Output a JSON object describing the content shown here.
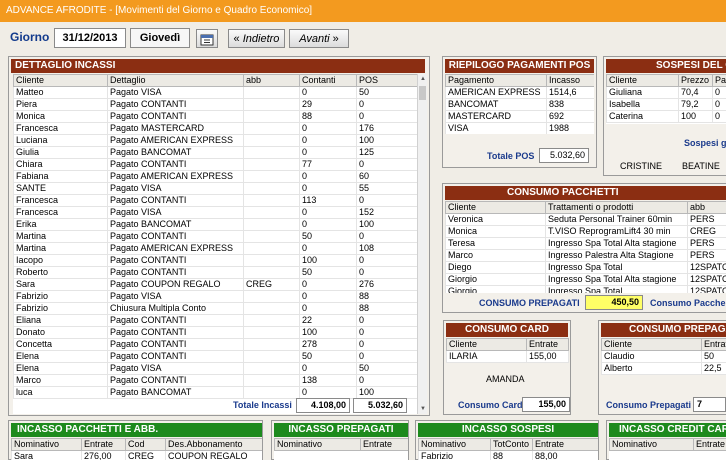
{
  "window": {
    "title": "ADVANCE AFRODITE - [Movimenti del Giorno e Quadro Economico]"
  },
  "nav": {
    "giorno_label": "Giorno",
    "date": "31/12/2013",
    "weekday": "Giovedì",
    "prev_label": "Indietro",
    "next_label": "Avanti"
  },
  "incassi": {
    "title": "DETTAGLIO INCASSI",
    "columns": [
      "Cliente",
      "Dettaglio",
      "abb",
      "Contanti",
      "POS"
    ],
    "rows": [
      [
        "Matteo",
        "Pagato VISA",
        "",
        "0",
        "50"
      ],
      [
        "Piera",
        "Pagato CONTANTI",
        "",
        "29",
        "0"
      ],
      [
        "Monica",
        "Pagato CONTANTI",
        "",
        "88",
        "0"
      ],
      [
        "Francesca",
        "Pagato MASTERCARD",
        "",
        "0",
        "176"
      ],
      [
        "Luciana",
        "Pagato AMERICAN EXPRESS",
        "",
        "0",
        "100"
      ],
      [
        "Giulia",
        "Pagato BANCOMAT",
        "",
        "0",
        "125"
      ],
      [
        "Chiara",
        "Pagato CONTANTI",
        "",
        "77",
        "0"
      ],
      [
        "Fabiana",
        "Pagato AMERICAN EXPRESS",
        "",
        "0",
        "60"
      ],
      [
        "SANTE",
        "Pagato VISA",
        "",
        "0",
        "55"
      ],
      [
        "Francesca",
        "Pagato CONTANTI",
        "",
        "113",
        "0"
      ],
      [
        "Francesca",
        "Pagato VISA",
        "",
        "0",
        "152"
      ],
      [
        "Erika",
        "Pagato BANCOMAT",
        "",
        "0",
        "100"
      ],
      [
        "Martina",
        "Pagato CONTANTI",
        "",
        "50",
        "0"
      ],
      [
        "Martina",
        "Pagato AMERICAN EXPRESS",
        "",
        "0",
        "108"
      ],
      [
        "Iacopo",
        "Pagato CONTANTI",
        "",
        "100",
        "0"
      ],
      [
        "Roberto",
        "Pagato CONTANTI",
        "",
        "50",
        "0"
      ],
      [
        "Sara",
        "Pagato COUPON REGALO",
        "CREG",
        "0",
        "276"
      ],
      [
        "Fabrizio",
        "Pagato VISA",
        "",
        "0",
        "88"
      ],
      [
        "Fabrizio",
        "Chiusura Multipla Conto",
        "",
        "0",
        "88"
      ],
      [
        "Eliana",
        "Pagato CONTANTI",
        "",
        "22",
        "0"
      ],
      [
        "Donato",
        "Pagato CONTANTI",
        "",
        "100",
        "0"
      ],
      [
        "Concetta",
        "Pagato CONTANTI",
        "",
        "278",
        "0"
      ],
      [
        "Elena",
        "Pagato CONTANTI",
        "",
        "50",
        "0"
      ],
      [
        "Elena",
        "Pagato VISA",
        "",
        "0",
        "50"
      ],
      [
        "Marco",
        "Pagato CONTANTI",
        "",
        "138",
        "0"
      ],
      [
        "luca",
        "Pagato BANCOMAT",
        "",
        "0",
        "100"
      ]
    ],
    "total_label": "Totale Incassi",
    "total_contanti": "4.108,00",
    "total_pos": "5.032,60"
  },
  "pos": {
    "title": "RIEPILOGO PAGAMENTI POS",
    "columns": [
      "Pagamento",
      "Incasso"
    ],
    "rows": [
      [
        "AMERICAN EXPRESS",
        "1514,6"
      ],
      [
        "BANCOMAT",
        "838"
      ],
      [
        "MASTERCARD",
        "692"
      ],
      [
        "VISA",
        "1988"
      ]
    ],
    "total_label": "Totale POS",
    "total": "5.032,60"
  },
  "sospesi": {
    "title": "SOSPESI DEL G",
    "columns": [
      "Cliente",
      "Prezzo",
      "Pag"
    ],
    "rows": [
      [
        "Giuliana",
        "70,4",
        "0"
      ],
      [
        "Isabella",
        "79,2",
        "0"
      ],
      [
        "Caterina",
        "100",
        "0"
      ]
    ],
    "sub_label": "Sospesi g",
    "names": [
      "CRISTINE",
      "BEATINE"
    ]
  },
  "pacchetti": {
    "title": "CONSUMO PACCHETTI",
    "columns": [
      "Cliente",
      "Trattamenti o prodotti",
      "abb"
    ],
    "rows": [
      [
        "Veronica",
        "Seduta Personal Trainer 60min",
        "PERS"
      ],
      [
        "Monica",
        "T.VISO ReprogramLift4 30 min",
        "CREG"
      ],
      [
        "Teresa",
        "Ingresso Spa Total Alta stagione",
        "PERS"
      ],
      [
        "Marco",
        "Ingresso Palestra Alta Stagione",
        "PERS"
      ],
      [
        "Diego",
        "Ingresso Spa Total",
        "12SPATO"
      ],
      [
        "Giorgio",
        "Ingresso Spa Total Alta stagione",
        "12SPATO"
      ],
      [
        "Giorgio",
        "Ingresso Spa Total",
        "12SPATO"
      ]
    ],
    "prepagati_label": "CONSUMO PREPAGATI",
    "prepagati_value": "450,50",
    "right_label": "Consumo Pacche"
  },
  "card": {
    "title": "CONSUMO CARD",
    "columns": [
      "Cliente",
      "Entrate"
    ],
    "rows": [
      [
        "ILARIA",
        "155,00"
      ]
    ],
    "note": "AMANDA",
    "total_label": "Consumo Card",
    "total": "155,00"
  },
  "prepagati": {
    "title": "CONSUMO PREPAGAT",
    "columns": [
      "Cliente",
      "Entrate"
    ],
    "rows": [
      [
        "Claudio",
        "50"
      ],
      [
        "Alberto",
        "22,5"
      ]
    ],
    "total_label": "Consumo Prepagati",
    "total": "7"
  },
  "bottom": {
    "pacchetti_abb": {
      "title": "INCASSO PACCHETTI E ABB.",
      "columns": [
        "Nominativo",
        "Entrate",
        "Cod",
        "Des.Abbonamento"
      ],
      "rows": [
        [
          "Sara",
          "276,00",
          "CREG",
          "COUPON REGALO"
        ]
      ]
    },
    "prepagati": {
      "title": "INCASSO PREPAGATI",
      "columns": [
        "Nominativo",
        "Entrate"
      ],
      "rows": []
    },
    "sospesi": {
      "title": "INCASSO SOSPESI",
      "columns": [
        "Nominativo",
        "TotConto",
        "Entrate"
      ],
      "rows": [
        [
          "Fabrizio",
          "88",
          "88,00"
        ]
      ]
    },
    "credit": {
      "title": "INCASSO CREDIT CARD",
      "columns": [
        "Nominativo",
        "Entrate"
      ],
      "rows": []
    }
  },
  "icons": {
    "calendar": "calendar-icon",
    "prev": "double-left-arrow-icon",
    "next": "double-right-arrow-icon"
  },
  "colors": {
    "titlebar": "#f39a1f",
    "header_brown": "#8b2e12",
    "header_green": "#1d8a1d",
    "highlight_yellow": "#ffff66",
    "label_blue": "#1a3a8c"
  }
}
